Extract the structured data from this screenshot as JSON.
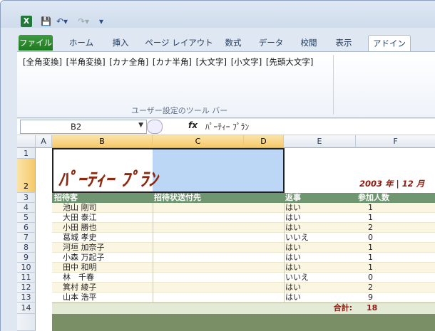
{
  "qat": {
    "app_icon": "excel-icon",
    "save": "save-icon",
    "undo": "undo-icon",
    "redo": "redo-icon"
  },
  "tabs": [
    "ファイル",
    "ホーム",
    "挿入",
    "ページ レイアウト",
    "数式",
    "データ",
    "校閲",
    "表示",
    "アドイン"
  ],
  "ribbon": {
    "tools": [
      "[全角変換]",
      "[半角変換]",
      "[カナ全角]",
      "[カナ半角]",
      "[大文字]",
      "[小文字]",
      "[先頭大文字]"
    ],
    "group_label": "ユーザー設定のツール バー"
  },
  "formula_bar": {
    "name_box": "B2",
    "fx": "fx",
    "value": "ﾊﾟｰﾃｨｰ ﾌﾟﾗﾝ"
  },
  "columns": [
    "A",
    "B",
    "C",
    "D",
    "E",
    "F"
  ],
  "rows": [
    "1",
    "2",
    "3",
    "4",
    "5",
    "6",
    "7",
    "8",
    "9",
    "10",
    "11",
    "12",
    "13",
    "14"
  ],
  "sheet": {
    "title": "ﾊﾟｰﾃｨｰ ﾌﾟﾗﾝ",
    "date": "2003 年 | 12 月",
    "headers": [
      "招待客",
      "招待状送付先",
      "返事",
      "参加人数"
    ],
    "guests": [
      {
        "name": "池山 剛司",
        "reply": "はい",
        "count": "1"
      },
      {
        "name": "大田 泰江",
        "reply": "はい",
        "count": "1"
      },
      {
        "name": "小田 勝也",
        "reply": "はい",
        "count": "2"
      },
      {
        "name": "葛城 孝史",
        "reply": "いいえ",
        "count": "0"
      },
      {
        "name": "河垣 加奈子",
        "reply": "はい",
        "count": "1"
      },
      {
        "name": "小森 万起子",
        "reply": "はい",
        "count": "1"
      },
      {
        "name": "田中 和明",
        "reply": "はい",
        "count": "1"
      },
      {
        "name": "林　千春",
        "reply": "いいえ",
        "count": "0"
      },
      {
        "name": "箕村 綾子",
        "reply": "はい",
        "count": "2"
      },
      {
        "name": "山本 浩平",
        "reply": "はい",
        "count": "9"
      }
    ],
    "total_label": "合計:",
    "total_value": "18"
  }
}
